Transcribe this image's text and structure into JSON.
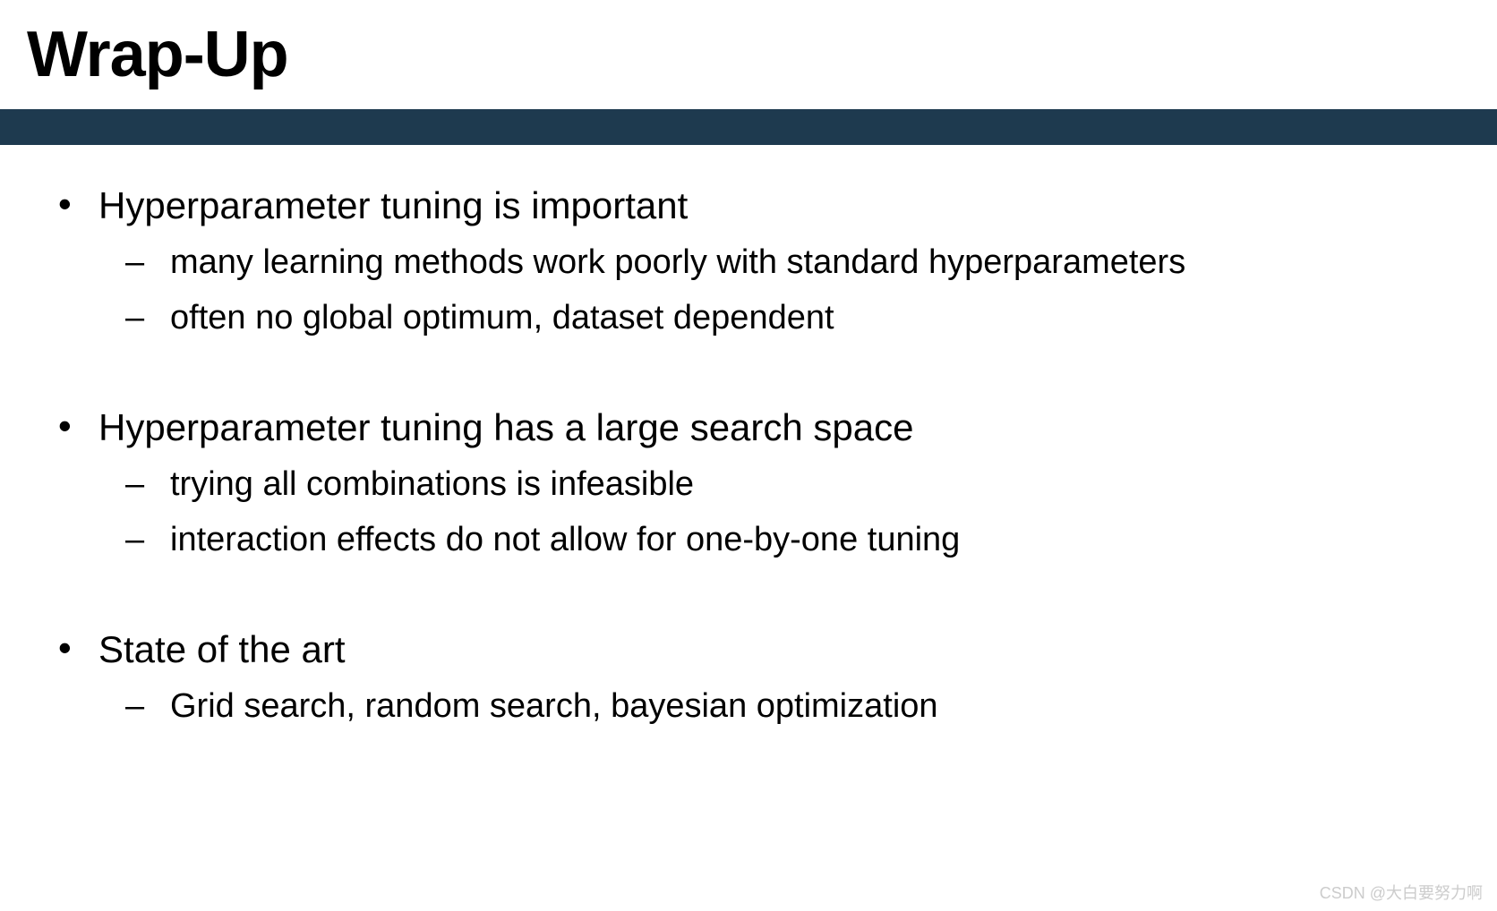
{
  "title": "Wrap-Up",
  "blocks": [
    {
      "main": "Hyperparameter tuning is important",
      "subs": [
        "many learning methods work poorly with standard hyperparameters",
        "often no global optimum, dataset dependent"
      ]
    },
    {
      "main": "Hyperparameter tuning has a large search space",
      "subs": [
        "trying all combinations is infeasible",
        "interaction effects do not allow for one-by-one tuning"
      ]
    },
    {
      "main": "State of the art",
      "subs": [
        "Grid search, random search, bayesian optimization"
      ]
    }
  ],
  "watermark": "CSDN @大白要努力啊"
}
